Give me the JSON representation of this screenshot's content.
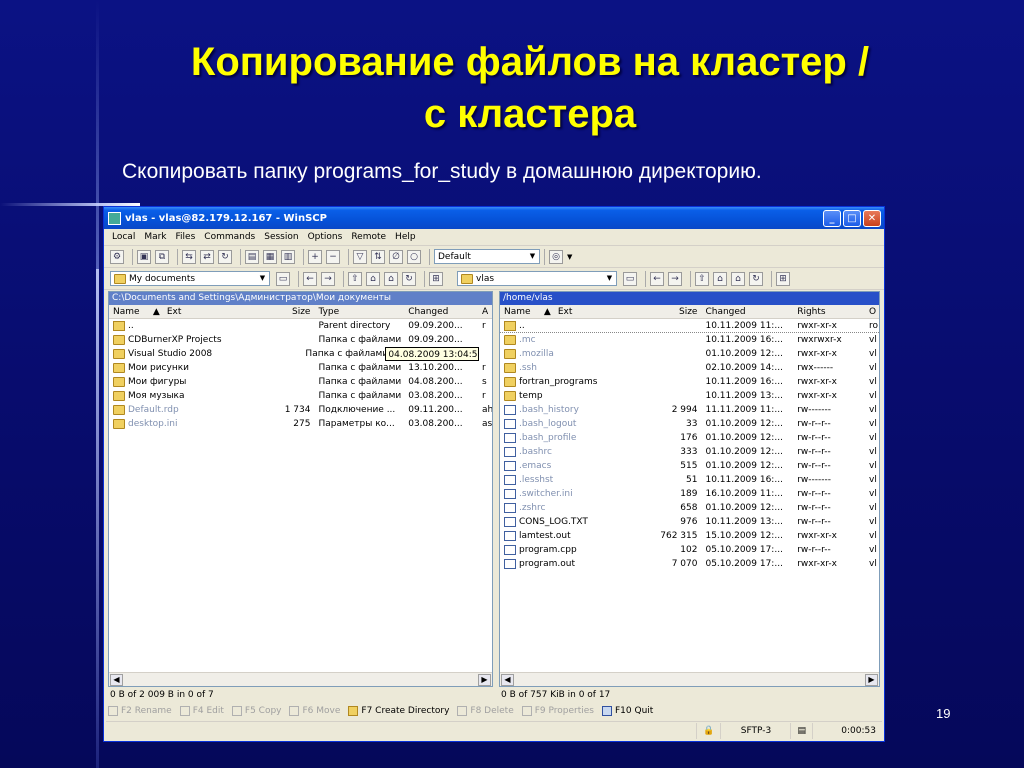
{
  "slide": {
    "title_line1": "Копирование файлов на кластер /",
    "title_line2": "с кластера",
    "subtitle": "Скопировать папку programs_for_study в домашнюю директорию.",
    "page": "19"
  },
  "window": {
    "title": "vlas - vlas@82.179.12.167 - WinSCP",
    "minimize": "_",
    "maximize": "□",
    "close": "✕"
  },
  "menu": [
    "Local",
    "Mark",
    "Files",
    "Commands",
    "Session",
    "Options",
    "Remote",
    "Help"
  ],
  "toolbar": {
    "session_profile": "Default"
  },
  "left_pane": {
    "location": "My documents",
    "path": "C:\\Documents and Settings\\Администратор\\Мои документы",
    "columns": [
      "Name",
      "Ext",
      "Size",
      "Type",
      "Changed",
      "A"
    ],
    "rows": [
      {
        "name": "..",
        "size": "",
        "type": "Parent directory",
        "changed": "09.09.200...",
        "attr": "r",
        "kind": "up"
      },
      {
        "name": "CDBurnerXP Projects",
        "size": "",
        "type": "Папка с файлами",
        "changed": "09.09.200...",
        "attr": "",
        "kind": "folder"
      },
      {
        "name": "Visual Studio 2008",
        "size": "",
        "type": "Папка с файлами",
        "changed": "04.08.2009  13:04:56",
        "attr": "",
        "kind": "folder"
      },
      {
        "name": "Мои рисунки",
        "size": "",
        "type": "Папка с файлами",
        "changed": "13.10.200...",
        "attr": "r",
        "kind": "folder"
      },
      {
        "name": "Мои фигуры",
        "size": "",
        "type": "Папка с файлами",
        "changed": "04.08.200...",
        "attr": "s",
        "kind": "folder"
      },
      {
        "name": "Моя музыка",
        "size": "",
        "type": "Папка с файлами",
        "changed": "03.08.200...",
        "attr": "r",
        "kind": "folder"
      },
      {
        "name": "Default.rdp",
        "size": "1 734",
        "type": "Подключение ...",
        "changed": "09.11.200...",
        "attr": "ah",
        "kind": "hidden"
      },
      {
        "name": "desktop.ini",
        "size": "275",
        "type": "Параметры ко...",
        "changed": "03.08.200...",
        "attr": "as",
        "kind": "hidden"
      }
    ],
    "status": "0 B of 2 009 B in 0 of 7"
  },
  "right_pane": {
    "location": "vlas",
    "path": "/home/vlas",
    "columns": [
      "Name",
      "Ext",
      "Size",
      "Changed",
      "Rights",
      "O"
    ],
    "rows": [
      {
        "name": "..",
        "size": "",
        "changed": "10.11.2009 11:...",
        "rights": "rwxr-xr-x",
        "owner": "ro",
        "kind": "up"
      },
      {
        "name": ".mc",
        "size": "",
        "changed": "10.11.2009 16:...",
        "rights": "rwxrwxr-x",
        "owner": "vl",
        "kind": "hidden"
      },
      {
        "name": ".mozilla",
        "size": "",
        "changed": "01.10.2009 12:...",
        "rights": "rwxr-xr-x",
        "owner": "vl",
        "kind": "hidden"
      },
      {
        "name": ".ssh",
        "size": "",
        "changed": "02.10.2009 14:...",
        "rights": "rwx------",
        "owner": "vl",
        "kind": "hidden"
      },
      {
        "name": "fortran_programs",
        "size": "",
        "changed": "10.11.2009 16:...",
        "rights": "rwxr-xr-x",
        "owner": "vl",
        "kind": "folder"
      },
      {
        "name": "temp",
        "size": "",
        "changed": "10.11.2009 13:...",
        "rights": "rwxr-xr-x",
        "owner": "vl",
        "kind": "folder"
      },
      {
        "name": ".bash_history",
        "size": "2 994",
        "changed": "11.11.2009 11:...",
        "rights": "rw-------",
        "owner": "vl",
        "kind": "hfile"
      },
      {
        "name": ".bash_logout",
        "size": "33",
        "changed": "01.10.2009 12:...",
        "rights": "rw-r--r--",
        "owner": "vl",
        "kind": "hfile"
      },
      {
        "name": ".bash_profile",
        "size": "176",
        "changed": "01.10.2009 12:...",
        "rights": "rw-r--r--",
        "owner": "vl",
        "kind": "hfile"
      },
      {
        "name": ".bashrc",
        "size": "333",
        "changed": "01.10.2009 12:...",
        "rights": "rw-r--r--",
        "owner": "vl",
        "kind": "hfile"
      },
      {
        "name": ".emacs",
        "size": "515",
        "changed": "01.10.2009 12:...",
        "rights": "rw-r--r--",
        "owner": "vl",
        "kind": "hfile"
      },
      {
        "name": ".lesshst",
        "size": "51",
        "changed": "10.11.2009 16:...",
        "rights": "rw-------",
        "owner": "vl",
        "kind": "hfile"
      },
      {
        "name": ".switcher.ini",
        "size": "189",
        "changed": "16.10.2009 11:...",
        "rights": "rw-r--r--",
        "owner": "vl",
        "kind": "hfile"
      },
      {
        "name": ".zshrc",
        "size": "658",
        "changed": "01.10.2009 12:...",
        "rights": "rw-r--r--",
        "owner": "vl",
        "kind": "hfile"
      },
      {
        "name": "CONS_LOG.TXT",
        "size": "976",
        "changed": "10.11.2009 13:...",
        "rights": "rw-r--r--",
        "owner": "vl",
        "kind": "file"
      },
      {
        "name": "lamtest.out",
        "size": "762 315",
        "changed": "15.10.2009 12:...",
        "rights": "rwxr-xr-x",
        "owner": "vl",
        "kind": "file"
      },
      {
        "name": "program.cpp",
        "size": "102",
        "changed": "05.10.2009 17:...",
        "rights": "rw-r--r--",
        "owner": "vl",
        "kind": "file"
      },
      {
        "name": "program.out",
        "size": "7 070",
        "changed": "05.10.2009 17:...",
        "rights": "rwxr-xr-x",
        "owner": "vl",
        "kind": "file"
      }
    ],
    "status": "0 B of 757 KiB in 0 of 17"
  },
  "function_keys": [
    {
      "label": "F2 Rename",
      "enabled": false
    },
    {
      "label": "F4 Edit",
      "enabled": false
    },
    {
      "label": "F5 Copy",
      "enabled": false
    },
    {
      "label": "F6 Move",
      "enabled": false
    },
    {
      "label": "F7 Create Directory",
      "enabled": true
    },
    {
      "label": "F8 Delete",
      "enabled": false
    },
    {
      "label": "F9 Properties",
      "enabled": false
    },
    {
      "label": "F10 Quit",
      "enabled": true
    }
  ],
  "statusbar": {
    "protocol": "SFTP-3",
    "elapsed": "0:00:53"
  }
}
